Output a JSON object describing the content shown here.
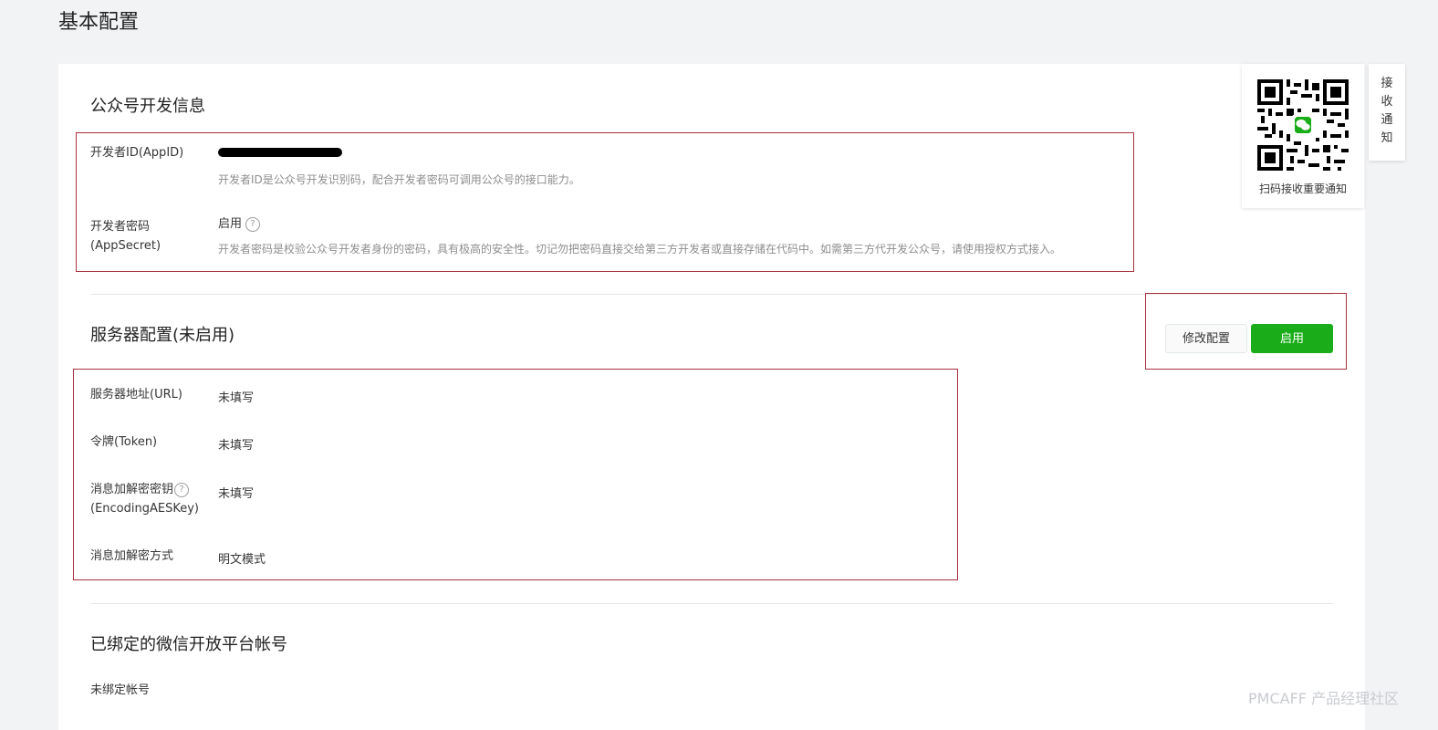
{
  "page_title": "基本配置",
  "dev_info": {
    "title": "公众号开发信息",
    "appid_label": "开发者ID(AppID)",
    "appid_desc": "开发者ID是公众号开发识别码，配合开发者密码可调用公众号的接口能力。",
    "secret_label_line1": "开发者密码",
    "secret_label_line2": "(AppSecret)",
    "secret_status": "启用",
    "secret_desc": "开发者密码是校验公众号开发者身份的密码，具有极高的安全性。切记勿把密码直接交给第三方开发者或直接存储在代码中。如需第三方代开发公众号，请使用授权方式接入。"
  },
  "server_config": {
    "title": "服务器配置(未启用)",
    "modify_button": "修改配置",
    "enable_button": "启用",
    "url_label": "服务器地址(URL)",
    "url_value": "未填写",
    "token_label": "令牌(Token)",
    "token_value": "未填写",
    "aeskey_label_line1": "消息加解密密钥",
    "aeskey_label_line2": "(EncodingAESKey)",
    "aeskey_value": "未填写",
    "encrypt_label": "消息加解密方式",
    "encrypt_value": "明文模式"
  },
  "open_platform": {
    "title": "已绑定的微信开放平台帐号",
    "status": "未绑定帐号"
  },
  "qr": {
    "caption": "扫码接收重要通知"
  },
  "side_tab": {
    "chars": [
      "接",
      "收",
      "通",
      "知"
    ]
  },
  "help_icon_glyph": "?",
  "watermark": "PMCAFF 产品经理社区",
  "colors": {
    "primary": "#1aad19",
    "highlight_border": "#a8323e",
    "background": "#f2f3f5"
  }
}
